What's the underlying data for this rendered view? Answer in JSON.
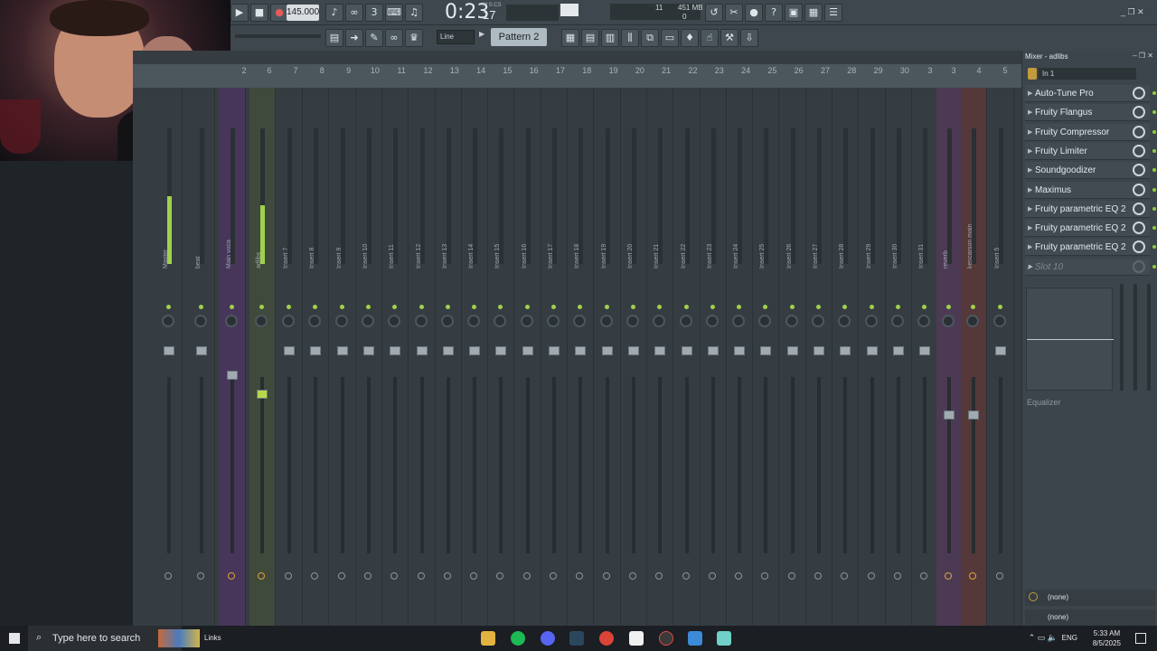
{
  "toolbar": {
    "tempo": "145.000",
    "time": "0:23",
    "time_frac": "17",
    "time_unit": "M:S:CS",
    "cpu": "11",
    "cpu_sub": "0",
    "memory": "451 MB",
    "snap": "Line",
    "pattern": "Pattern 2"
  },
  "mixer": {
    "ruler_numbers": [
      "2",
      "6",
      "7",
      "8",
      "9",
      "10",
      "11",
      "12",
      "13",
      "14",
      "15",
      "16",
      "17",
      "18",
      "19",
      "20",
      "21",
      "22",
      "23",
      "24",
      "25",
      "26",
      "27",
      "28",
      "29",
      "30",
      "3",
      "3",
      "4",
      "5"
    ],
    "tracks": [
      "Master",
      "beat",
      "Main voca",
      "adlibs",
      "Insert 7",
      "Insert 8",
      "Insert 9",
      "Insert 10",
      "Insert 11",
      "Insert 12",
      "Insert 13",
      "Insert 14",
      "Insert 15",
      "Insert 16",
      "Insert 17",
      "Insert 18",
      "Insert 19",
      "Insert 20",
      "Insert 21",
      "Insert 22",
      "Insert 23",
      "Insert 24",
      "Insert 25",
      "Insert 26",
      "Insert 27",
      "Insert 28",
      "Insert 29",
      "Insert 30",
      "Insert 31",
      "reverb",
      "kencarson main",
      "Insert 5"
    ]
  },
  "panel": {
    "title": "Mixer - adlibs",
    "input": "In 1",
    "slots": [
      "Auto-Tune Pro",
      "Fruity Flangus",
      "Fruity Compressor",
      "Fruity Limiter",
      "Soundgoodizer",
      "Maximus",
      "Fruity parametric EQ 2",
      "Fruity parametric EQ 2",
      "Fruity parametric EQ 2",
      "Slot 10"
    ],
    "eq_label": "Equalizer",
    "none1": "(none)",
    "none2": "(none)"
  },
  "taskbar": {
    "search_placeholder": "Type here to search",
    "links": "Links",
    "lang": "ENG",
    "time": "5:33 AM",
    "date": "8/5/2025"
  }
}
